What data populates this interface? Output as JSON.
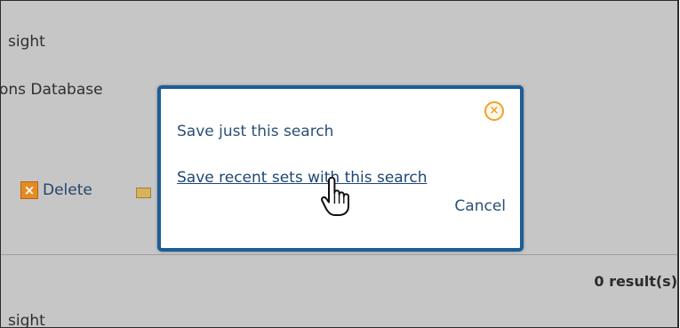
{
  "background": {
    "line1": "sight",
    "line2": "ons Database",
    "delete_label": "Delete",
    "results_label": "0 result(s)",
    "bottom_line": "sight"
  },
  "dialog": {
    "option_just": "Save just this search",
    "option_recent": "Save recent sets with this search",
    "cancel_label": "Cancel",
    "close_icon": "close-icon"
  },
  "colors": {
    "dialog_border": "#1b5d97",
    "link": "#2b4f75",
    "close_accent": "#f0a12a",
    "overlay_gray": "#c6c6c6"
  }
}
